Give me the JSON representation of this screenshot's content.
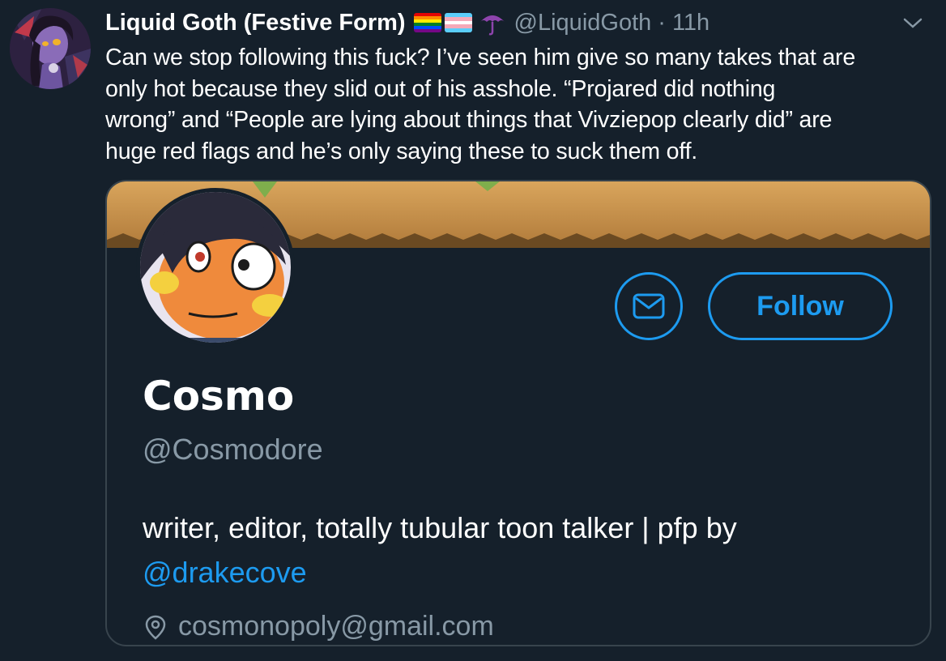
{
  "tweet": {
    "display_name": "Liquid Goth (Festive Form)",
    "badges": [
      "rainbow-flag-icon",
      "trans-flag-icon",
      "umbrella-icon"
    ],
    "handle": "@LiquidGoth",
    "separator": "·",
    "time": "11h",
    "text_lines": [
      "Can we stop following this fuck? I’ve seen him give so many takes that are",
      "only hot because they slid out of his asshole. “Projared did nothing",
      "wrong” and “People are lying about things that Vivziepop clearly did” are",
      "huge red flags and he’s only saying these to suck them off."
    ]
  },
  "profile_card": {
    "name": "Cosmo",
    "handle": "@Cosmodore",
    "follow_label": "Follow",
    "bio_text": "writer, editor, totally tubular toon talker | pfp by",
    "bio_link": "@drakecove",
    "location": "cosmonopoly@gmail.com"
  },
  "colors": {
    "background": "#15202b",
    "text": "#ffffff",
    "secondary": "#8899a6",
    "accent": "#1d9bf0",
    "border": "#38444d"
  }
}
